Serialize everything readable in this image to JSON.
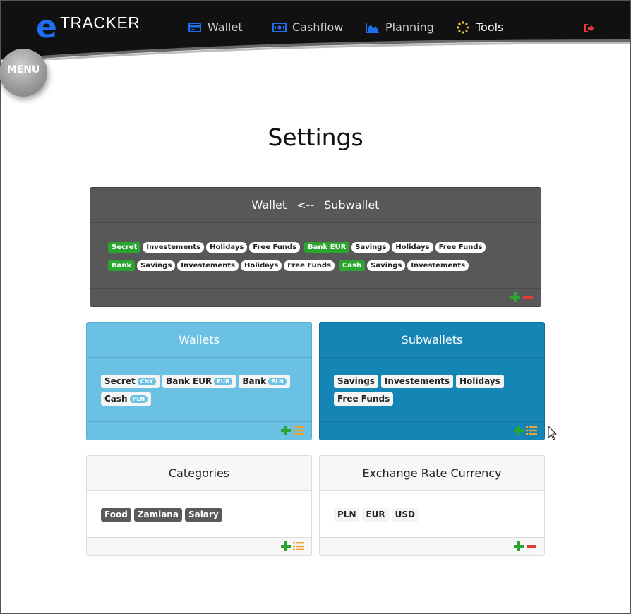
{
  "header": {
    "brand_e": "e",
    "brand_tracker": "TRACKER",
    "nav": [
      {
        "label": "Wallet",
        "icon": "credit-card-icon",
        "color": "#1e6ff0"
      },
      {
        "label": "Cashflow",
        "icon": "money-bill-icon",
        "color": "#1e6ff0"
      },
      {
        "label": "Planning",
        "icon": "area-chart-icon",
        "color": "#1e6ff0"
      },
      {
        "label": "Tools",
        "icon": "spinner-icon",
        "color": "#f2c94c",
        "active": true
      }
    ],
    "logout_icon": "sign-out-icon"
  },
  "menu": {
    "label": "MENU"
  },
  "page": {
    "title": "Settings"
  },
  "mapping_card": {
    "header_left": "Wallet",
    "header_arrow": "<--",
    "header_right": "Subwallet",
    "groups": [
      {
        "wallet": "Secret",
        "subwallets": [
          "Investements",
          "Holidays",
          "Free Funds"
        ]
      },
      {
        "wallet": "Bank EUR",
        "subwallets": [
          "Savings",
          "Holidays",
          "Free Funds"
        ]
      },
      {
        "wallet": "Bank",
        "subwallets": [
          "Savings",
          "Investements",
          "Holidays",
          "Free Funds"
        ]
      },
      {
        "wallet": "Cash",
        "subwallets": [
          "Savings",
          "Investements"
        ]
      }
    ]
  },
  "wallets_card": {
    "title": "Wallets",
    "items": [
      {
        "name": "Secret",
        "currency": "CNY"
      },
      {
        "name": "Bank EUR",
        "currency": "EUR"
      },
      {
        "name": "Bank",
        "currency": "PLN"
      },
      {
        "name": "Cash",
        "currency": "PLN"
      }
    ]
  },
  "subwallets_card": {
    "title": "Subwallets",
    "items": [
      "Savings",
      "Investements",
      "Holidays",
      "Free Funds"
    ]
  },
  "categories_card": {
    "title": "Categories",
    "items": [
      "Food",
      "Zamiana",
      "Salary"
    ]
  },
  "currency_card": {
    "title": "Exchange Rate Currency",
    "items": [
      "PLN",
      "EUR",
      "USD"
    ]
  },
  "colors": {
    "accent_blue": "#1e6ff0",
    "add_green": "#2aa52f",
    "remove_red": "#e53935",
    "list_orange": "#f0a030"
  }
}
